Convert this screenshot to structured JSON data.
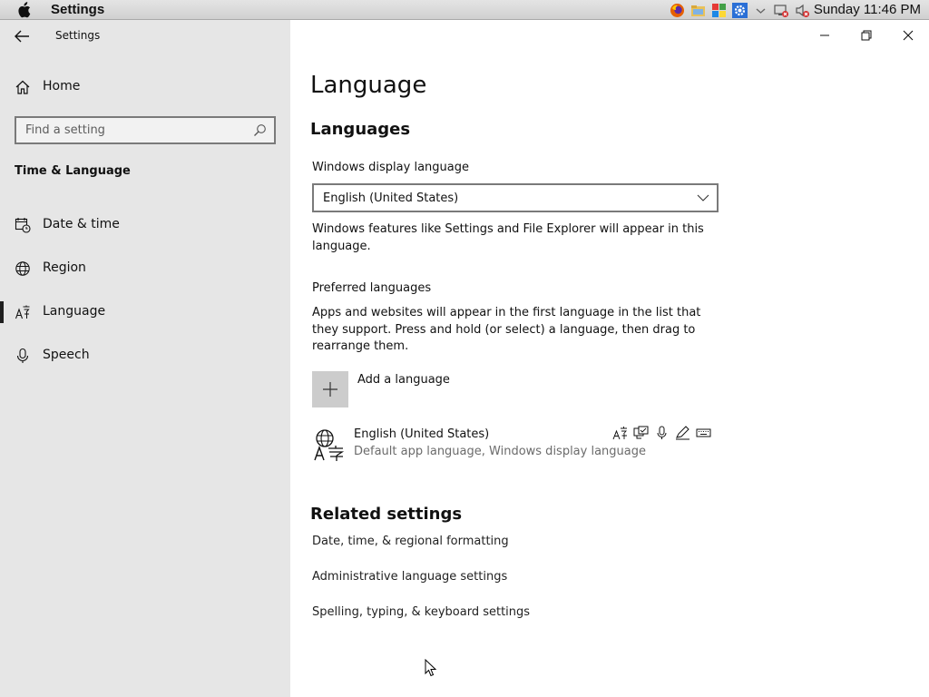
{
  "menubar": {
    "app_name": "Settings",
    "clock": "Sunday 11:46 PM",
    "tray_icons": [
      "firefox-icon",
      "folder-icon",
      "color-squares-icon",
      "gear-icon",
      "chevron-down-icon",
      "network-disabled-icon",
      "volume-muted-icon"
    ]
  },
  "window": {
    "title": "Settings",
    "controls": [
      "minimize-icon",
      "restore-icon",
      "close-icon"
    ]
  },
  "sidebar": {
    "home_label": "Home",
    "search_placeholder": "Find a setting",
    "section": "Time & Language",
    "items": [
      {
        "label": "Date & time",
        "icon": "calendar-clock-icon"
      },
      {
        "label": "Region",
        "icon": "globe-icon"
      },
      {
        "label": "Language",
        "icon": "language-icon",
        "active": true
      },
      {
        "label": "Speech",
        "icon": "microphone-icon"
      }
    ]
  },
  "main": {
    "title": "Language",
    "languages_heading": "Languages",
    "display_language_label": "Windows display language",
    "display_language_value": "English (United States)",
    "display_language_note": "Windows features like Settings and File Explorer will appear in this language.",
    "preferred_label": "Preferred languages",
    "preferred_note": "Apps and websites will appear in the first language in the list that they support. Press and hold (or select) a language, then drag to rearrange them.",
    "add_language": "Add a language",
    "installed_language": {
      "name": "English (United States)",
      "subtitle": "Default app language, Windows display language",
      "feature_icons": [
        "display-language-icon",
        "text-to-speech-icon",
        "speech-recognition-icon",
        "handwriting-icon",
        "keyboard-icon"
      ]
    },
    "related_heading": "Related settings",
    "related_links": [
      "Date, time, & regional formatting",
      "Administrative language settings",
      "Spelling, typing, & keyboard settings"
    ]
  }
}
